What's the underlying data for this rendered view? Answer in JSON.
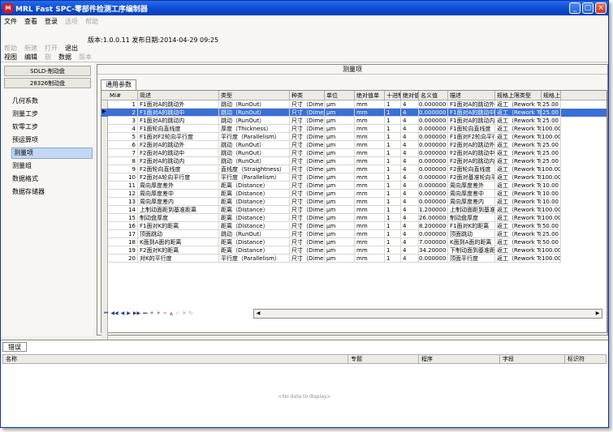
{
  "window": {
    "icon": "M",
    "title": "MRL Fast SPC-零部件检测工序编制器",
    "minimize": "_",
    "maximize": "□",
    "close": "×"
  },
  "menubar": {
    "file": "文件",
    "view": "查看",
    "login": "登录",
    "options": "选项",
    "help": "帮助"
  },
  "toolbar": {
    "help": "帮助",
    "new": "新建",
    "open": "打开",
    "exit": "退出",
    "version": "版本:1.0.0.11 发布日期:2014-04-29 09:25",
    "view": "视图",
    "edit": "编辑",
    "ti": "剔",
    "data": "数据",
    "version_tab": "版本"
  },
  "sidebar": {
    "parts": [
      "SDLD-制动盘",
      "28326制动盘"
    ],
    "items": [
      "几何系数",
      "测量工步",
      "软零工步",
      "预运算项",
      "测量项",
      "测量组",
      "数据格式",
      "数据存储器"
    ],
    "selected_index": 4
  },
  "main": {
    "group_title": "测量项",
    "tab_label": "通用参数",
    "columns": [
      "MI#",
      "简述",
      "类型",
      "种类",
      "单位",
      "绝对值单",
      "十进制",
      "绝对值",
      "名义值",
      "描述",
      "规格上限类型",
      "规格上"
    ],
    "rows": [
      [
        "1",
        "F1面对A的跳动外",
        "跳动（RunOut）",
        "尺寸（Dime",
        "μm",
        "mm",
        "1",
        "4",
        "0.000000",
        "F1面对A的跳动外",
        "返工（Rework Toll",
        "25.00"
      ],
      [
        "2",
        "F1面对A的跳动中",
        "跳动（RunOut）",
        "尺寸（Dime",
        "μm",
        "mm",
        "1",
        "4",
        "0.000000",
        "F1面对A的跳动中",
        "返工（Rework Toll",
        "25.00"
      ],
      [
        "3",
        "F1面对A的跳动内",
        "跳动（RunOut）",
        "尺寸（Dime",
        "μm",
        "mm",
        "1",
        "4",
        "0.000000",
        "F1面对A的跳动内",
        "返工（Rework Toll",
        "25.00"
      ],
      [
        "4",
        "F1面轮向直线度",
        "厚度（Thickness）",
        "尺寸（Dime",
        "μm",
        "mm",
        "1",
        "4",
        "0.000000",
        "F1面轮向直线度",
        "返工（Rework Toll",
        "100.00"
      ],
      [
        "5",
        "F1面对F2轮向平行度",
        "平行度（Parallelism）",
        "尺寸（Dime",
        "μm",
        "mm",
        "1",
        "4",
        "0.000000",
        "F1面对F2轮向平行度",
        "返工（Rework Toll",
        "100.00"
      ],
      [
        "6",
        "F2面对A的跳动外",
        "跳动（RunOut）",
        "尺寸（Dime",
        "μm",
        "mm",
        "1",
        "4",
        "0.000000",
        "F2面对A的跳动外",
        "返工（Rework Toll",
        "25.00"
      ],
      [
        "7",
        "F2面对A的跳动中",
        "跳动（RunOut）",
        "尺寸（Dime",
        "μm",
        "mm",
        "1",
        "4",
        "0.000000",
        "F2面对A的跳动中",
        "返工（Rework Toll",
        "25.00"
      ],
      [
        "8",
        "F2面对A的跳动内",
        "跳动（RunOut）",
        "尺寸（Dime",
        "μm",
        "mm",
        "1",
        "4",
        "0.000000",
        "F2面对A的跳动内",
        "返工（Rework Toll",
        "25.00"
      ],
      [
        "9",
        "F2面轮向直线度",
        "直线度（Straightness）",
        "尺寸（Dime",
        "μm",
        "mm",
        "1",
        "4",
        "0.000000",
        "F2面轮向直线度",
        "返工（Rework Toll",
        "100.00"
      ],
      [
        "10",
        "F2面对A轮向平行度",
        "平行度（Parallelism）",
        "尺寸（Dime",
        "μm",
        "mm",
        "1",
        "4",
        "0.000000",
        "F2面对基准轮向平行度",
        "返工（Rework Toll",
        "100.00"
      ],
      [
        "11",
        "周向厚度差外",
        "距离（Distance）",
        "尺寸（Dime",
        "μm",
        "mm",
        "1",
        "4",
        "0.000000",
        "周向厚度差外",
        "返工（Rework Toll",
        "10.00"
      ],
      [
        "12",
        "周向厚度差中",
        "距离（Distance）",
        "尺寸（Dime",
        "μm",
        "mm",
        "1",
        "4",
        "0.000000",
        "周向厚度差中",
        "返工（Rework Toll",
        "10.00"
      ],
      [
        "13",
        "周向厚度差内",
        "距离（Distance）",
        "尺寸（Dime",
        "μm",
        "mm",
        "1",
        "4",
        "0.000000",
        "周向厚度差内",
        "返工（Rework Toll",
        "10.00"
      ],
      [
        "14",
        "上制动面距到基准距离",
        "距离（Distance）",
        "尺寸（Dime",
        "μm",
        "mm",
        "1",
        "4",
        "1.200000",
        "上制动面距到基准距离",
        "返工（Rework Toll",
        "100.00"
      ],
      [
        "15",
        "制动盘厚度",
        "距离（Distance）",
        "尺寸（Dime",
        "μm",
        "mm",
        "1",
        "4",
        "26.00000",
        "制动盘厚度",
        "返工（Rework Toll",
        "100.00"
      ],
      [
        "16",
        "F1面对K的距离",
        "距离（Distance）",
        "尺寸（Dime",
        "μm",
        "mm",
        "1",
        "4",
        "8.200000",
        "F1面对K的距离",
        "返工（Rework Toll",
        "50.00"
      ],
      [
        "17",
        "顶面跳动",
        "跳动（RunOut）",
        "尺寸（Dime",
        "μm",
        "mm",
        "1",
        "4",
        "0.000000",
        "顶面跳动",
        "返工（Rework Toll",
        "25.00"
      ],
      [
        "18",
        "K面到A面的距离",
        "距离（Distance）",
        "尺寸（Dime",
        "μm",
        "mm",
        "1",
        "4",
        "7.000000",
        "K面到A面的距离",
        "返工（Rework Toll",
        "50.00"
      ],
      [
        "19",
        "F2面对K的距离",
        "距离（Distance）",
        "尺寸（Dime",
        "μm",
        "mm",
        "1",
        "4",
        "34.20000",
        "下制动面到基准距离",
        "返工（Rework Toll",
        "100.00"
      ],
      [
        "20",
        "对K的平行度",
        "平行度（Parallelism）",
        "尺寸（Dime",
        "μm",
        "mm",
        "1",
        "4",
        "0.000000",
        "顶面平行度",
        "返工（Rework Toll",
        "100.00"
      ]
    ],
    "selected_row": 1
  },
  "navigator": {
    "first": "⏮",
    "prev_page": "◀◀",
    "prev": "◀",
    "next": "▶",
    "next_page": "▶▶",
    "last": "⏭",
    "add": "+",
    "copy": "+",
    "remove": "−",
    "up": "▲",
    "ok": "✓",
    "cancel": "✕",
    "refresh": "↻"
  },
  "errors": {
    "tab_label": "错误",
    "columns": [
      "名称",
      "专题",
      "程序",
      "字段",
      "标识符"
    ],
    "empty_text": "<No data to display>"
  },
  "colors": {
    "titlebar": "#0b4ad0",
    "selection": "#3b6fd8",
    "close": "#c33c1a"
  }
}
